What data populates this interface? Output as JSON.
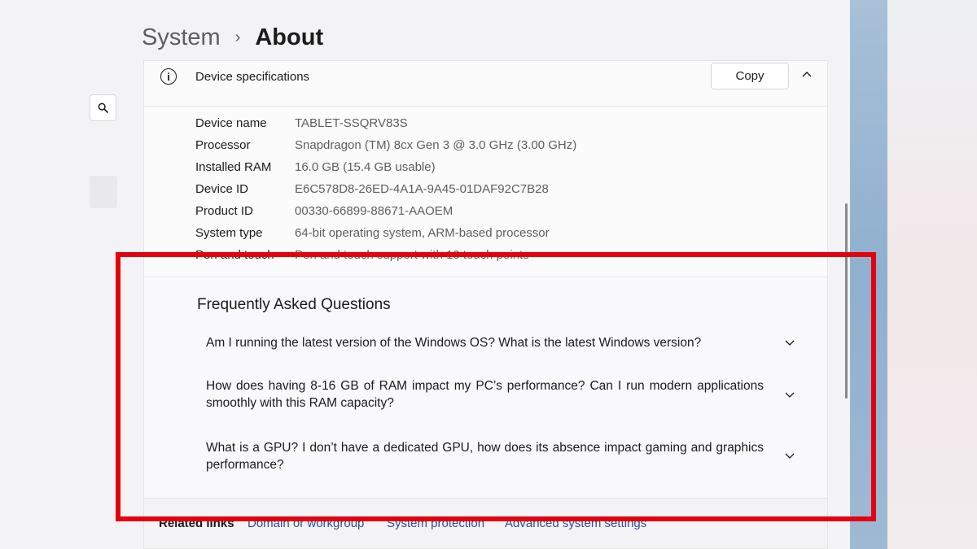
{
  "breadcrumb": {
    "parent": "System",
    "separator": "›",
    "current": "About"
  },
  "device_specs": {
    "title": "Device specifications",
    "copy_label": "Copy",
    "info_glyph": "i",
    "rows": [
      {
        "label": "Device name",
        "value": "TABLET-SSQRV83S"
      },
      {
        "label": "Processor",
        "value": "Snapdragon (TM) 8cx Gen 3 @ 3.0 GHz (3.00 GHz)"
      },
      {
        "label": "Installed RAM",
        "value": "16.0 GB (15.4 GB usable)"
      },
      {
        "label": "Device ID",
        "value": "E6C578D8-26ED-4A1A-9A45-01DAF92C7B28"
      },
      {
        "label": "Product ID",
        "value": "00330-66899-88671-AAOEM"
      },
      {
        "label": "System type",
        "value": "64-bit operating system, ARM-based processor"
      },
      {
        "label": "Pen and touch",
        "value": "Pen and touch support with 10 touch points"
      }
    ]
  },
  "faq": {
    "title": "Frequently Asked Questions",
    "items": [
      {
        "question": "Am I running the latest version of the Windows OS? What is the latest Windows version?"
      },
      {
        "question": "How does having 8-16 GB of RAM impact my PC’s performance? Can I run modern applications smoothly with this RAM capacity?"
      },
      {
        "question": "What is a GPU? I don’t have a dedicated GPU, how does its absence impact gaming and graphics performance?"
      }
    ]
  },
  "related": {
    "label": "Related links",
    "links": [
      "Domain or workgroup",
      "System protection",
      "Advanced system settings"
    ]
  },
  "icons": {
    "search": "search-icon",
    "info": "info-icon",
    "collapse": "chevron-up-icon",
    "expand": "chevron-down-icon"
  },
  "colors": {
    "highlight": "#e3000f",
    "link": "#2c4f8c",
    "secondary_text": "#5e5e5e"
  }
}
